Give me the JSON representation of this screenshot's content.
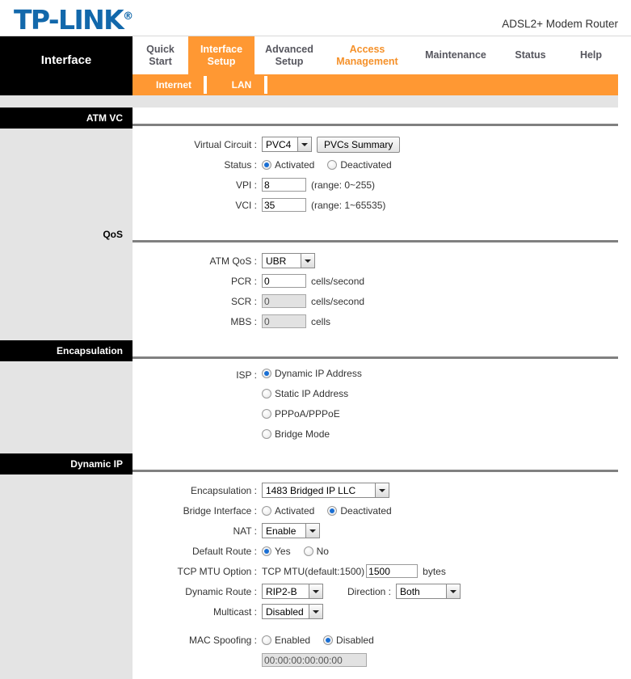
{
  "header": {
    "logo_text": "TP-LINK",
    "logo_reg": "®",
    "model": "ADSL2+ Modem Router"
  },
  "nav": {
    "section_label": "Interface",
    "tabs": [
      {
        "label": "Quick\nStart",
        "active": false
      },
      {
        "label": "Interface\nSetup",
        "active": true
      },
      {
        "label": "Advanced\nSetup",
        "active": false
      },
      {
        "label": "Access\nManagement",
        "active": false
      },
      {
        "label": "Maintenance",
        "active": false
      },
      {
        "label": "Status",
        "active": false
      },
      {
        "label": "Help",
        "active": false
      }
    ],
    "subtabs": [
      {
        "label": "Internet",
        "active": true
      },
      {
        "label": "LAN",
        "active": false
      }
    ]
  },
  "sections": {
    "atm_vc": {
      "title": "ATM VC",
      "virtual_circuit_label": "Virtual Circuit :",
      "virtual_circuit_value": "PVC4",
      "pvcs_summary_button": "PVCs Summary",
      "status_label": "Status :",
      "status_options": [
        "Activated",
        "Deactivated"
      ],
      "status_selected": "Activated",
      "vpi_label": "VPI :",
      "vpi_value": "8",
      "vpi_range": "(range: 0~255)",
      "vci_label": "VCI :",
      "vci_value": "35",
      "vci_range": "(range: 1~65535)"
    },
    "qos": {
      "title": "QoS",
      "atm_qos_label": "ATM QoS :",
      "atm_qos_value": "UBR",
      "pcr_label": "PCR :",
      "pcr_value": "0",
      "pcr_unit": "cells/second",
      "scr_label": "SCR :",
      "scr_value": "0",
      "scr_unit": "cells/second",
      "mbs_label": "MBS :",
      "mbs_value": "0",
      "mbs_unit": "cells"
    },
    "encapsulation": {
      "title": "Encapsulation",
      "isp_label": "ISP :",
      "isp_options": [
        "Dynamic IP Address",
        "Static IP Address",
        "PPPoA/PPPoE",
        "Bridge Mode"
      ],
      "isp_selected": "Dynamic IP Address"
    },
    "dynamic_ip": {
      "title": "Dynamic IP",
      "encapsulation_label": "Encapsulation :",
      "encapsulation_value": "1483 Bridged IP LLC",
      "bridge_interface_label": "Bridge Interface :",
      "bridge_interface_options": [
        "Activated",
        "Deactivated"
      ],
      "bridge_interface_selected": "Deactivated",
      "nat_label": "NAT :",
      "nat_value": "Enable",
      "default_route_label": "Default Route :",
      "default_route_options": [
        "Yes",
        "No"
      ],
      "default_route_selected": "Yes",
      "tcp_mtu_label": "TCP MTU Option :",
      "tcp_mtu_prefix": "TCP MTU(default:1500)",
      "tcp_mtu_value": "1500",
      "tcp_mtu_unit": "bytes",
      "dynamic_route_label": "Dynamic Route :",
      "dynamic_route_value": "RIP2-B",
      "direction_label": "Direction :",
      "direction_value": "Both",
      "multicast_label": "Multicast :",
      "multicast_value": "Disabled",
      "mac_spoofing_label": "MAC Spoofing :",
      "mac_spoofing_options": [
        "Enabled",
        "Disabled"
      ],
      "mac_spoofing_selected": "Disabled",
      "mac_address_value": "00:00:00:00:00:00"
    }
  }
}
